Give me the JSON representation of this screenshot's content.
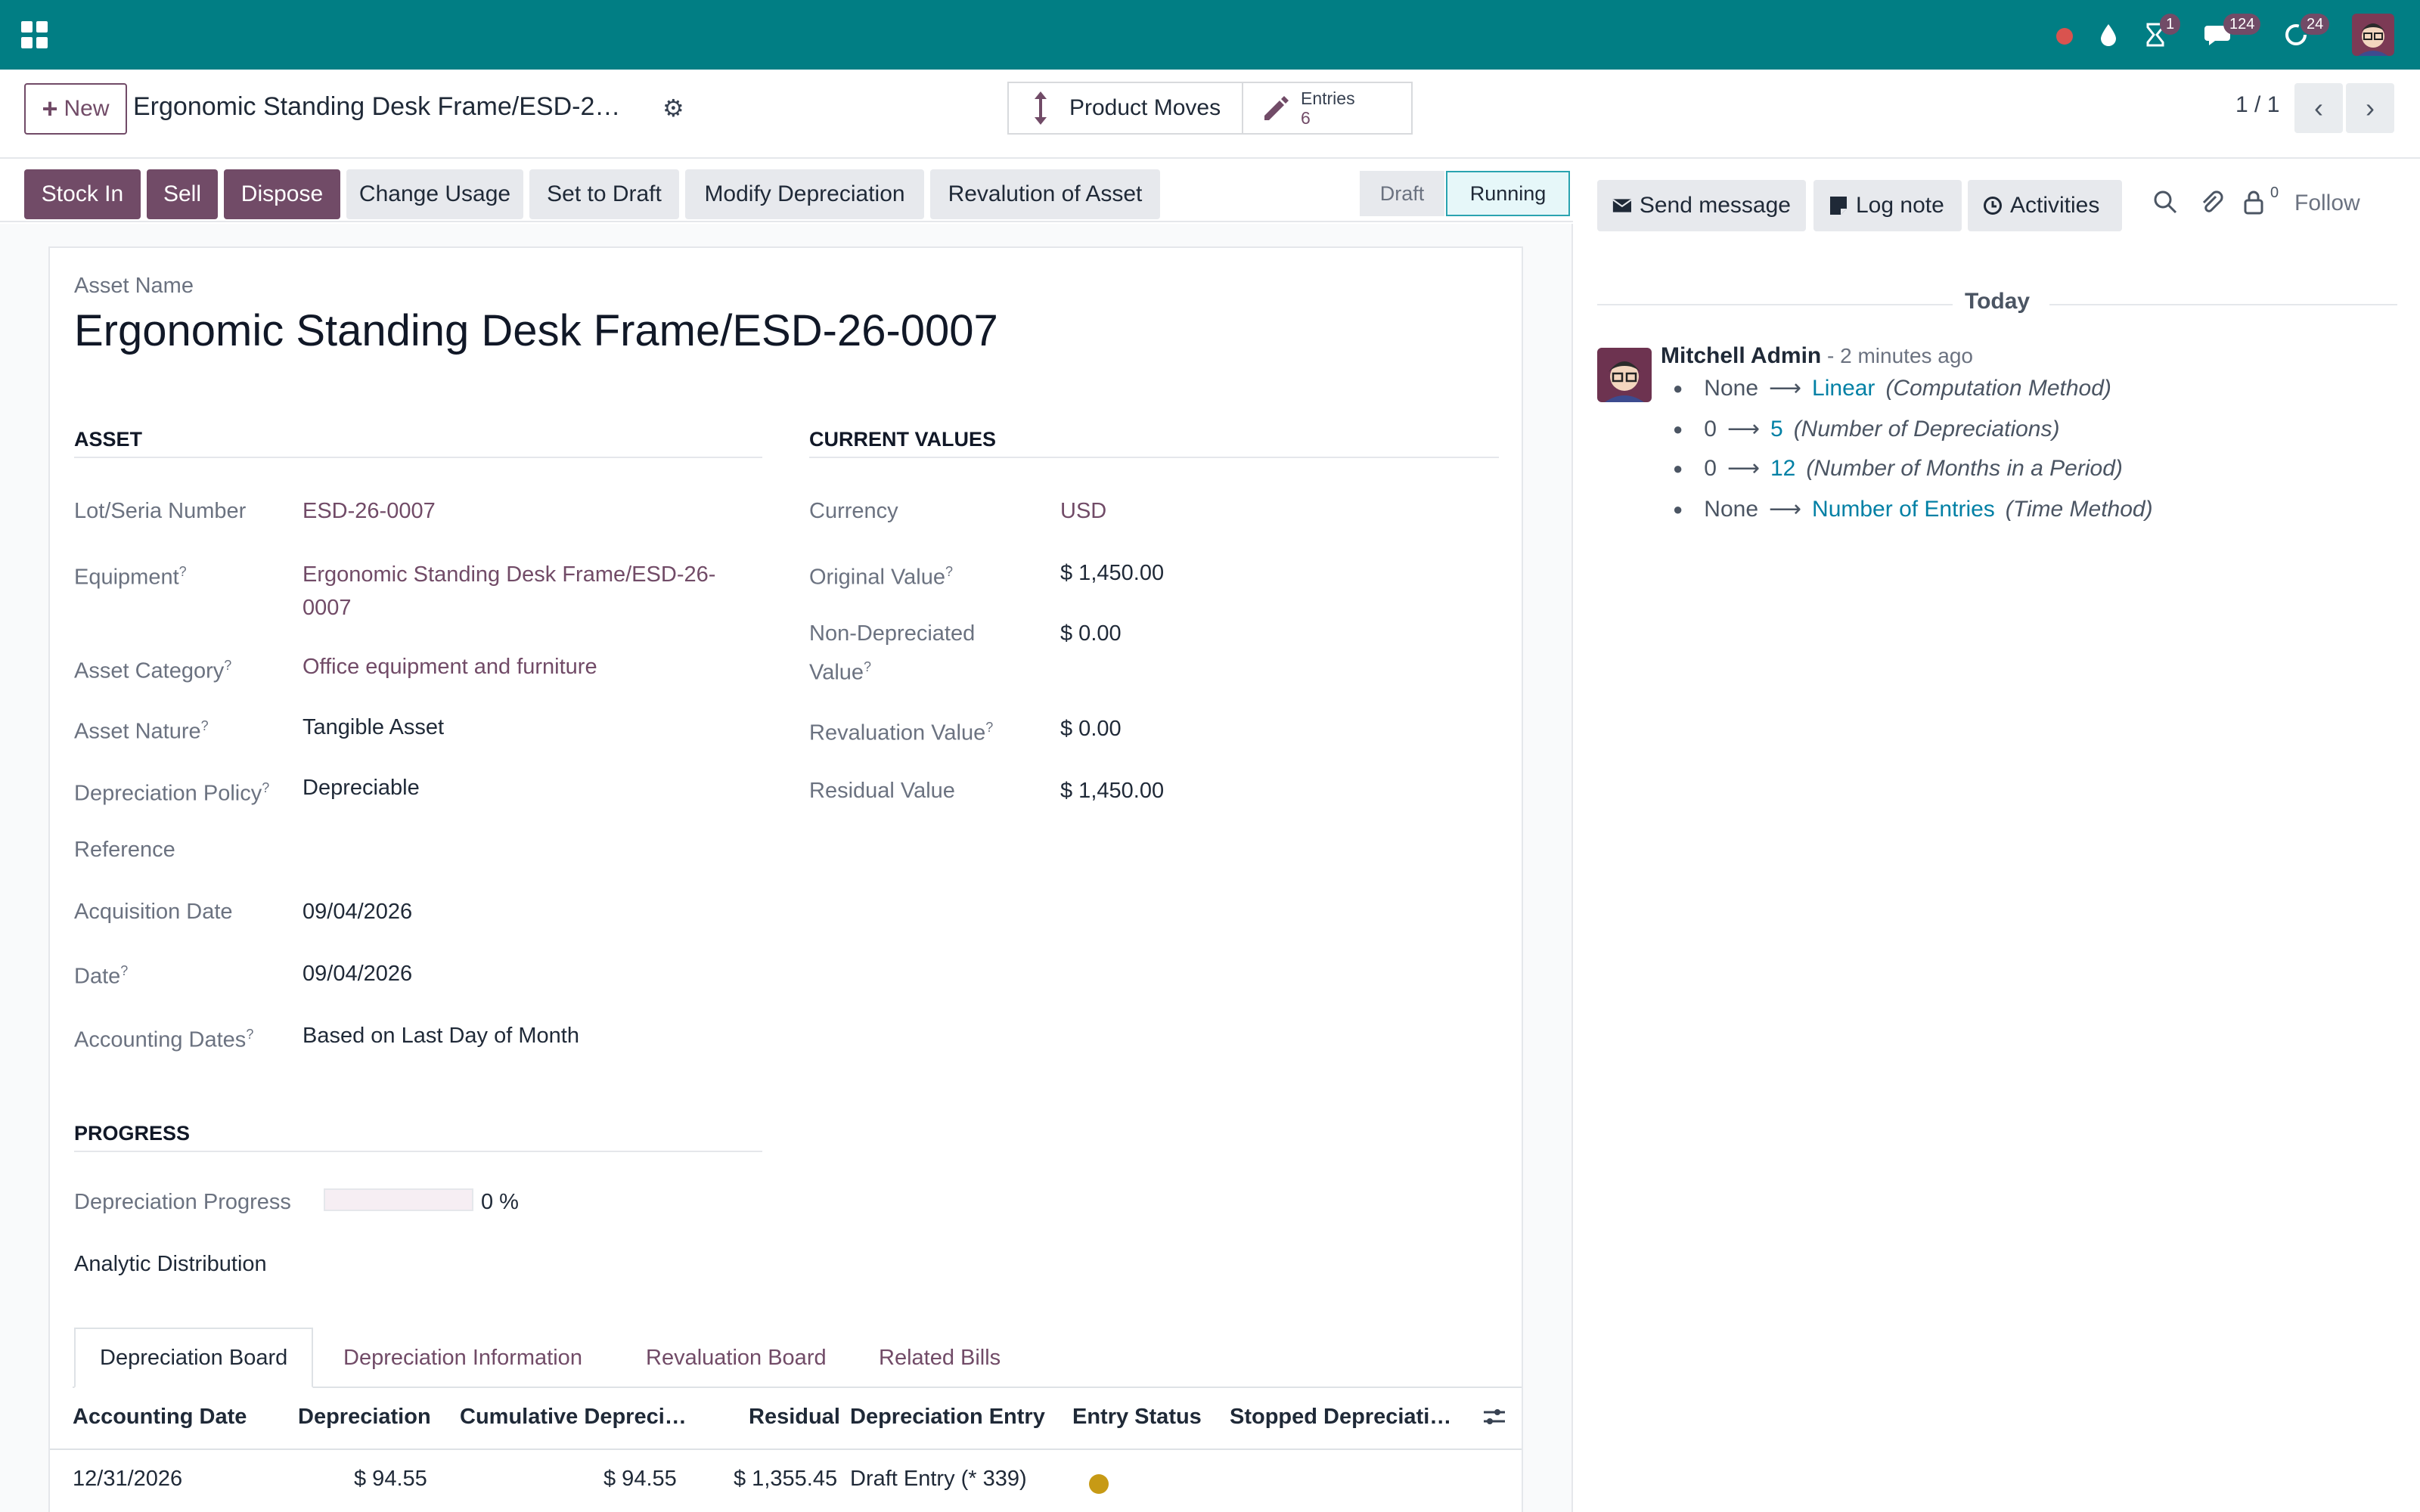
{
  "navbar": {
    "notification_badges": {
      "activities": "1",
      "messages": "124",
      "updates": "24"
    }
  },
  "control_panel": {
    "new_button": "New",
    "breadcrumb_title": "Ergonomic Standing Desk Frame/ESD-2…",
    "smart_buttons": {
      "product_moves": "Product Moves",
      "entries_label": "Entries",
      "entries_count": "6"
    },
    "pager": "1 / 1"
  },
  "status_bar": {
    "buttons": [
      "Stock In",
      "Sell",
      "Dispose",
      "Change Usage",
      "Set to Draft",
      "Modify Depreciation",
      "Revalution of Asset"
    ],
    "stages": [
      "Draft",
      "Running"
    ],
    "active_stage": "Running"
  },
  "form": {
    "asset_name_label": "Asset Name",
    "asset_name": "Ergonomic Standing Desk Frame/ESD-26-0007",
    "asset_section": {
      "heading": "ASSET",
      "fields": {
        "lot_label": "Lot/Seria Number",
        "lot_value": "ESD-26-0007",
        "equipment_label": "Equipment",
        "equipment_value_1": "Ergonomic Standing Desk Frame/ESD-26-",
        "equipment_value_2": "0007",
        "category_label": "Asset Category",
        "category_value": "Office equipment and furniture",
        "nature_label": "Asset Nature",
        "nature_value": "Tangible Asset",
        "policy_label": "Depreciation Policy",
        "policy_value": "Depreciable",
        "reference_label": "Reference",
        "acq_date_label": "Acquisition Date",
        "acq_date_value": "09/04/2026",
        "date_label": "Date",
        "date_value": "09/04/2026",
        "acc_dates_label": "Accounting Dates",
        "acc_dates_value": "Based on Last Day of Month"
      }
    },
    "values_section": {
      "heading": "CURRENT VALUES",
      "fields": {
        "currency_label": "Currency",
        "currency_value": "USD",
        "original_label": "Original Value",
        "original_value": "$ 1,450.00",
        "nondep_label_1": "Non-Depreciated",
        "nondep_label_2": "Value",
        "nondep_value": "$ 0.00",
        "reval_label": "Revaluation Value",
        "reval_value": "$ 0.00",
        "residual_label": "Residual Value",
        "residual_value": "$ 1,450.00"
      }
    },
    "progress_section": {
      "heading": "PROGRESS",
      "progress_label": "Depreciation Progress",
      "progress_value": "0 %",
      "progress_fraction": 0,
      "analytic_label": "Analytic Distribution"
    },
    "tooltip_marker": "?"
  },
  "tabs": [
    "Depreciation Board",
    "Depreciation Information",
    "Revaluation Board",
    "Related Bills"
  ],
  "table": {
    "columns": [
      "Accounting Date",
      "Depreciation",
      "Cumulative Depreci…",
      "Residual",
      "Depreciation Entry",
      "Entry Status",
      "Stopped Depreciati…"
    ],
    "rows": [
      {
        "date": "12/31/2026",
        "depreciation": "$ 94.55",
        "cumulative": "$ 94.55",
        "residual": "$ 1,355.45",
        "entry": "Draft Entry (* 339)",
        "status_color": "#c79a15"
      }
    ]
  },
  "chatter": {
    "send_message": "Send message",
    "log_note": "Log note",
    "activities": "Activities",
    "followers_count": "0",
    "follow": "Follow",
    "date_separator": "Today",
    "message": {
      "author": "Mitchell Admin",
      "time": " - 2 minutes ago",
      "tracking": [
        {
          "old": "None",
          "new": "Linear",
          "field": "(Computation Method)"
        },
        {
          "old": "0",
          "new": "5",
          "field": "(Number of Depreciations)"
        },
        {
          "old": "0",
          "new": "12",
          "field": "(Number of Months in a Period)"
        },
        {
          "old": "None",
          "new": "Number of Entries",
          "field": "(Time Method)"
        }
      ]
    }
  },
  "colors": {
    "navbar": "#017e84",
    "primary": "#714b67",
    "link": "#0180a5",
    "status_warning": "#c79a15"
  }
}
